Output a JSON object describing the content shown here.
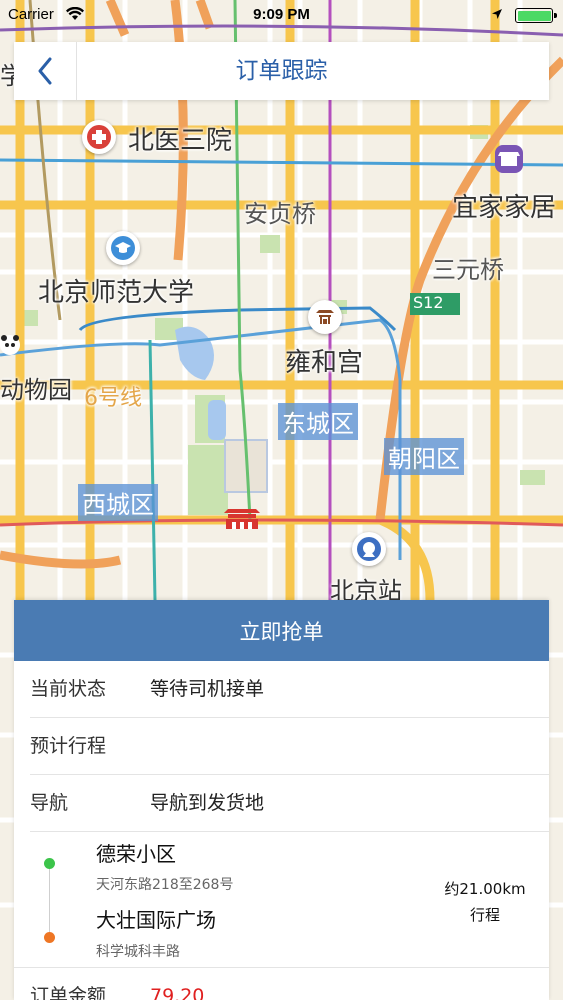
{
  "status_bar": {
    "carrier": "Carrier",
    "time": "9:09 PM"
  },
  "nav": {
    "title": "订单跟踪"
  },
  "map": {
    "labels": [
      {
        "name": "北医三院",
        "kind": "place"
      },
      {
        "name": "安贞桥",
        "kind": "place"
      },
      {
        "name": "宜家家居",
        "kind": "place"
      },
      {
        "name": "三元桥",
        "kind": "place"
      },
      {
        "name": "北京师范大学",
        "kind": "place"
      },
      {
        "name": "雍和宫",
        "kind": "place"
      },
      {
        "name": "动物园",
        "kind": "place"
      },
      {
        "name": "6号线",
        "kind": "metro"
      },
      {
        "name": "北京站",
        "kind": "place"
      },
      {
        "name": "学",
        "kind": "place"
      },
      {
        "name": "S12",
        "kind": "road"
      }
    ],
    "districts": [
      "东城区",
      "朝阳区",
      "西城区"
    ]
  },
  "order": {
    "grab_button": "立即抢单",
    "rows": [
      {
        "key": "当前状态",
        "value": "等待司机接单"
      },
      {
        "key": "预计行程",
        "value": ""
      },
      {
        "key": "导航",
        "value": "导航到发货地"
      }
    ],
    "route": {
      "from_name": "德荣小区",
      "from_addr": "天河东路218至268号",
      "to_name": "大壮国际广场",
      "to_addr": "科学城科丰路",
      "distance": "约21.00km",
      "distance_label": "行程"
    },
    "amount_label": "订单金额",
    "amount_value": "79.20"
  },
  "colors": {
    "accent": "#4a7bb3",
    "nav_title": "#2a5fa8",
    "start_dot": "#3cc44a",
    "end_dot": "#ee7624",
    "amount": "#e02020"
  }
}
